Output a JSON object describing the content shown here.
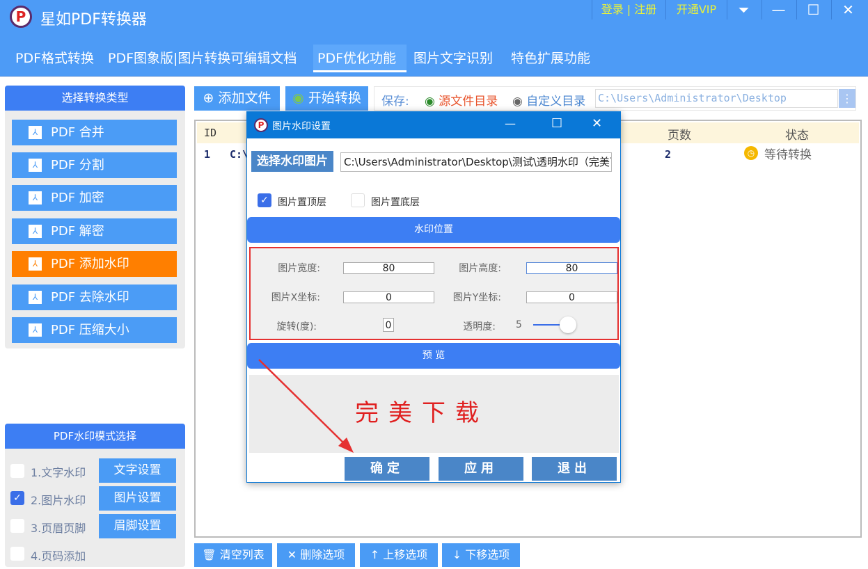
{
  "app": {
    "title": "星如PDF转换器",
    "logo_letter": "P",
    "login": "登录",
    "separator": "|",
    "register": "注册",
    "vip": "开通VIP"
  },
  "tabs": [
    {
      "label": "PDF格式转换"
    },
    {
      "label": "PDF图象版|图片转换可编辑文档"
    },
    {
      "label": "PDF优化功能"
    },
    {
      "label": "图片文字识别"
    },
    {
      "label": "特色扩展功能"
    }
  ],
  "sidebar": {
    "title": "选择转换类型",
    "items": [
      {
        "label": "PDF 合并"
      },
      {
        "label": "PDF 分割"
      },
      {
        "label": "PDF 加密"
      },
      {
        "label": "PDF 解密"
      },
      {
        "label": "PDF 添加水印"
      },
      {
        "label": "PDF 去除水印"
      },
      {
        "label": "PDF 压缩大小"
      }
    ]
  },
  "mode_panel": {
    "title": "PDF水印模式选择",
    "modes": [
      {
        "label": "1.文字水印",
        "checked": false,
        "button": "文字设置"
      },
      {
        "label": "2.图片水印",
        "checked": true,
        "button": "图片设置"
      },
      {
        "label": "3.页眉页脚",
        "checked": false,
        "button": "眉脚设置"
      },
      {
        "label": "4.页码添加",
        "checked": false
      }
    ]
  },
  "toolbar": {
    "add_file": "添加文件",
    "start": "开始转换",
    "save_label": "保存:",
    "source_dir": "源文件目录",
    "custom_dir": "自定义目录",
    "path": "C:\\Users\\Administrator\\Desktop"
  },
  "table": {
    "headers": {
      "id": "ID",
      "pages": "页数",
      "status": "状态"
    },
    "rows": [
      {
        "id": "1",
        "file": "C:\\",
        "pages": "2",
        "status": "等待转换"
      }
    ]
  },
  "bottom_buttons": {
    "clear": "清空列表",
    "delete": "删除选项",
    "up": "上移选项",
    "down": "下移选项"
  },
  "dialog": {
    "title": "图片水印设置",
    "select_image": "选择水印图片",
    "image_path": "C:\\Users\\Administrator\\Desktop\\测试\\透明水印（完美下",
    "top_layer": "图片置顶层",
    "top_layer_checked": true,
    "bottom_layer": "图片置底层",
    "bottom_layer_checked": false,
    "position_header": "水印位置",
    "width_label": "图片宽度:",
    "width": "80",
    "height_label": "图片高度:",
    "height": "80",
    "x_label": "图片X坐标:",
    "x": "0",
    "y_label": "图片Y坐标:",
    "y": "0",
    "rotation_label": "旋转(度):",
    "rotation": "0",
    "opacity_label": "透明度:",
    "opacity": "5",
    "preview_header": "预 览",
    "preview_text": "完美下载",
    "ok": "确定",
    "apply": "应用",
    "exit": "退出"
  },
  "colors": {
    "header": "#4d9bf6",
    "active": "#ff7f00",
    "dialog_title": "#0a78d7",
    "preview_text": "#e02020"
  }
}
